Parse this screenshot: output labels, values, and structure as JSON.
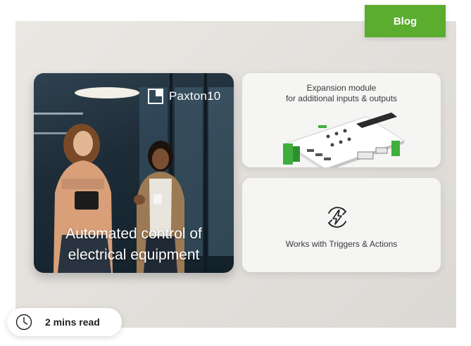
{
  "tag": {
    "label": "Blog",
    "color": "#5aad2e"
  },
  "photo_card": {
    "brand": {
      "logo_icon": "paxton-square-logo-icon",
      "name": "Paxton10"
    },
    "caption_line1": "Automated control of",
    "caption_line2": "electrical equipment"
  },
  "feature_cards": [
    {
      "title_line1": "Expansion module",
      "title_line2": "for additional inputs & outputs",
      "image": "expansion-module-board"
    },
    {
      "icon": "refresh-lightning-icon",
      "text": "Works with Triggers & Actions"
    }
  ],
  "read_time": {
    "icon": "clock-icon",
    "label": "2 mins read"
  }
}
